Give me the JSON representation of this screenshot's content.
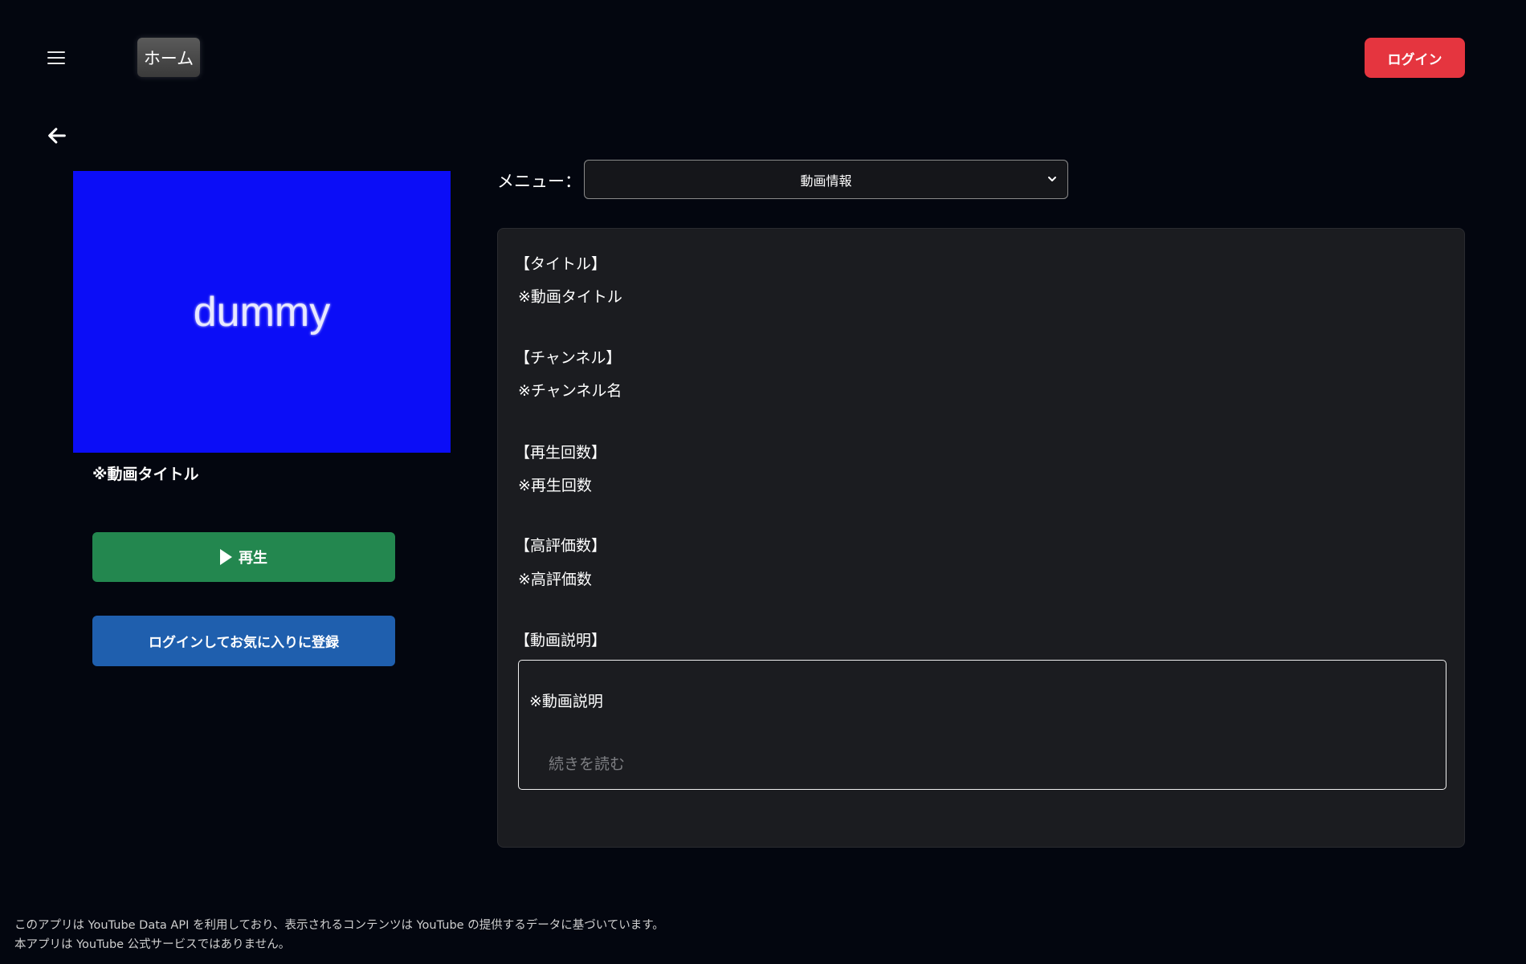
{
  "header": {
    "home_label": "ホーム",
    "login_label": "ログイン"
  },
  "video": {
    "thumbnail_text": "dummy",
    "title": "※動画タイトル",
    "play_label": "再生",
    "favorite_label": "ログインしてお気に入りに登録"
  },
  "menu": {
    "label": "メニュー：",
    "selected": "動画情報"
  },
  "info": {
    "title_label": "【タイトル】",
    "title_value": "※動画タイトル",
    "channel_label": "【チャンネル】",
    "channel_value": "※チャンネル名",
    "views_label": "【再生回数】",
    "views_value": "※再生回数",
    "likes_label": "【高評価数】",
    "likes_value": "※高評価数",
    "description_label": "【動画説明】",
    "description_value": "※動画説明",
    "read_more": "続きを読む"
  },
  "footer": {
    "line1": "このアプリは YouTube Data API を利用しており、表示されるコンテンツは YouTube の提供するデータに基づいています。",
    "line2": "本アプリは YouTube 公式サービスではありません。"
  },
  "colors": {
    "background": "#03060f",
    "login": "#e5353f",
    "play": "#23874f",
    "favorite": "#1f5fae",
    "thumbnail": "#0b0df7",
    "panel": "#1b1c20"
  }
}
